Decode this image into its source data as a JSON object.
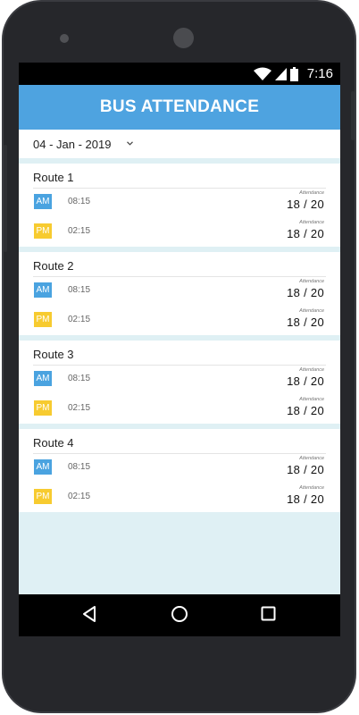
{
  "status_bar": {
    "time": "7:16"
  },
  "app": {
    "title": "BUS ATTENDANCE"
  },
  "date_selector": {
    "value": "04 - Jan - 2019"
  },
  "routes": [
    {
      "name": "Route 1",
      "am": {
        "badge": "AM",
        "time": "08:15",
        "label": "Attendance",
        "value": "18 / 20"
      },
      "pm": {
        "badge": "PM",
        "time": "02:15",
        "label": "Attendance",
        "value": "18 / 20"
      }
    },
    {
      "name": "Route 2",
      "am": {
        "badge": "AM",
        "time": "08:15",
        "label": "Attendance",
        "value": "18 / 20"
      },
      "pm": {
        "badge": "PM",
        "time": "02:15",
        "label": "Attendance",
        "value": "18 / 20"
      }
    },
    {
      "name": "Route 3",
      "am": {
        "badge": "AM",
        "time": "08:15",
        "label": "Attendance",
        "value": "18 / 20"
      },
      "pm": {
        "badge": "PM",
        "time": "02:15",
        "label": "Attendance",
        "value": "18 / 20"
      }
    },
    {
      "name": "Route 4",
      "am": {
        "badge": "AM",
        "time": "08:15",
        "label": "Attendance",
        "value": "18 / 20"
      },
      "pm": {
        "badge": "PM",
        "time": "02:15",
        "label": "Attendance",
        "value": "18 / 20"
      }
    }
  ],
  "icons": {
    "wifi": "wifi-icon",
    "signal": "signal-icon",
    "battery": "battery-icon",
    "back": "back-icon",
    "home": "home-icon",
    "recents": "recents-icon",
    "dropdown": "chevron-down-icon"
  },
  "colors": {
    "app_bar": "#4ea3e0",
    "am_badge": "#4aa3e0",
    "pm_badge": "#f7cb30",
    "screen_background": "#dff0f4"
  }
}
